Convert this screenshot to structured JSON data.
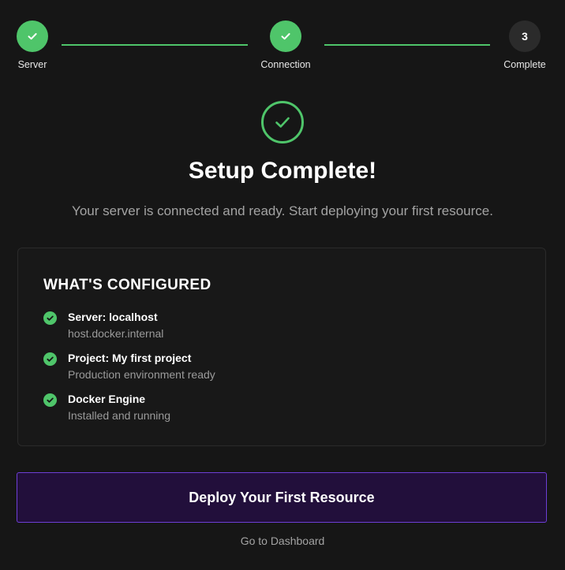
{
  "stepper": {
    "steps": [
      {
        "label": "Server",
        "status": "done"
      },
      {
        "label": "Connection",
        "status": "done"
      },
      {
        "label": "Complete",
        "status": "current",
        "number": "3"
      }
    ]
  },
  "hero": {
    "title": "Setup Complete!",
    "subtitle": "Your server is connected and ready. Start deploying your first resource."
  },
  "configured": {
    "heading": "WHAT'S CONFIGURED",
    "items": [
      {
        "title": "Server: localhost",
        "detail": "host.docker.internal"
      },
      {
        "title": "Project: My first project",
        "detail": "Production environment ready"
      },
      {
        "title": "Docker Engine",
        "detail": "Installed and running"
      }
    ]
  },
  "actions": {
    "primary_label": "Deploy Your First Resource",
    "secondary_label": "Go to Dashboard"
  },
  "colors": {
    "success": "#4fc56a",
    "accent_border": "#6d3fd6",
    "accent_bg": "#220f3b",
    "background": "#161616"
  },
  "icons": {
    "step_done": "check-icon",
    "hero": "check-circle-icon",
    "item": "check-circle-filled-icon"
  }
}
